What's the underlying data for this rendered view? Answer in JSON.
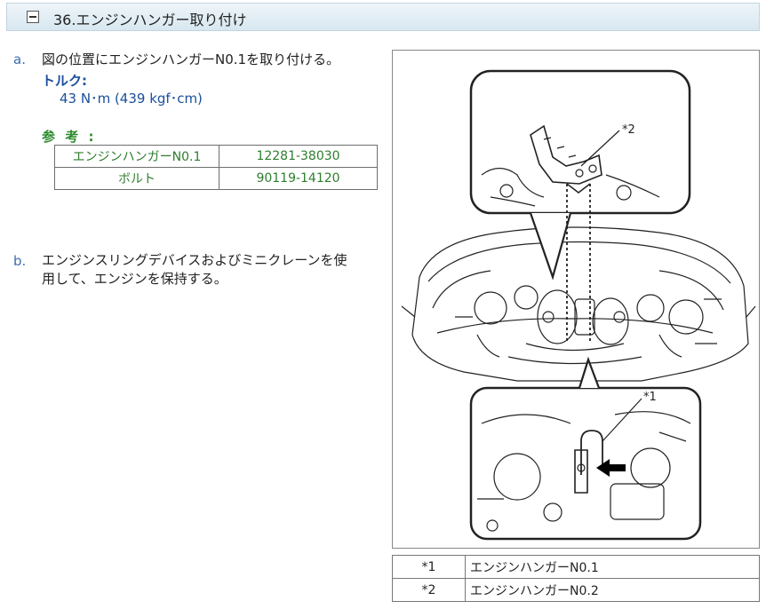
{
  "header": {
    "title": "36.エンジンハンガー取り付け"
  },
  "steps": [
    {
      "marker": "a.",
      "line1": "図の位置にエンジンハンガーN0.1を取り付ける。"
    },
    {
      "marker": "b.",
      "line1": "エンジンスリングデバイスおよびミニクレーンを使",
      "line2": "用して、エンジンを保持する。"
    }
  ],
  "torque": {
    "label": "トルク:",
    "value": "43 N･m (439 kgf･cm)"
  },
  "reference": {
    "label": "参 考 :",
    "rows": [
      {
        "part": "エンジンハンガーN0.1",
        "number": "12281-38030"
      },
      {
        "part": "ボルト",
        "number": "90119-14120"
      }
    ]
  },
  "figure": {
    "callouts": [
      "*1",
      "*2"
    ]
  },
  "legend": [
    {
      "key": "*1",
      "value": "エンジンハンガーN0.1"
    },
    {
      "key": "*2",
      "value": "エンジンハンガーN0.2"
    }
  ]
}
